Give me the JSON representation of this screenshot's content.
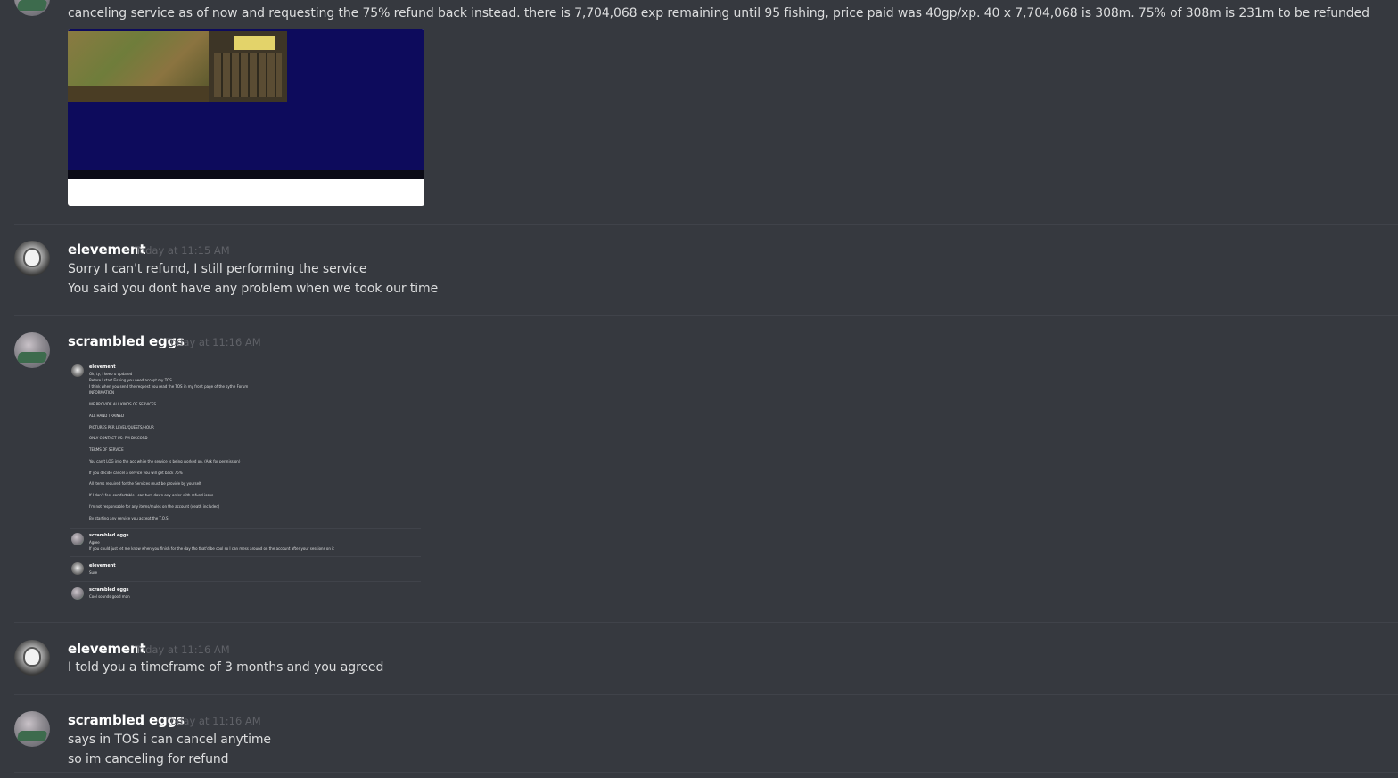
{
  "messages": [
    {
      "author": "scrambled eggs",
      "lines": [
        "canceling service as of now and requesting the 75% refund back instead. there is 7,704,068 exp remaining until 95 fishing, price paid was 40gp/xp. 40 x 7,704,068 is 308m. 75% of 308m is 231m to be  refunded"
      ]
    },
    {
      "author": "elevement",
      "timestamp": "Today at 11:15 AM",
      "lines": [
        "Sorry I can't refund, I still performing the service",
        "You said you dont have any problem when we took our time"
      ]
    },
    {
      "author": "scrambled eggs",
      "timestamp": "Today at 11:16 AM",
      "embed": {
        "messages": [
          {
            "author": "elevement",
            "lines": [
              "Ok, ty, I keep u updated",
              "Before I start Fishing you need accept my TOS",
              "I think when you send the request you read the TOS in my front page of the sythe Forum",
              "INFORMATION",
              "WE PROVIDE ALL KINDS OF SERVICES",
              "ALL HAND TRAINED",
              "PICTURES PER LEVEL/QUESTS/HOUR",
              "ONLY CONTACT US: PM DISCORD",
              "TERMS OF SERVICE",
              "You can't LOG into the acc while the service is being worked on. (Ask for permission)",
              "If you decide cancel a service you will get back 75%",
              "All items required for the Services must be provide by yourself",
              "If I don't feel comfortable I can turn down any order with refund issue",
              "I'm not responsable for any items/mules on the account (death included)",
              "By starting any service you accept the T.O.S."
            ]
          },
          {
            "author": "scrambled eggs",
            "lines": [
              "Agree",
              "If you could just let me know when you finish for the day tho that'd be cool so I can mess around on the account after your sessions on it"
            ]
          },
          {
            "author": "elevement",
            "lines": [
              "Sure"
            ]
          },
          {
            "author": "scrambled eggs",
            "lines": [
              "Cool sounds good man"
            ]
          }
        ]
      }
    },
    {
      "author": "elevement",
      "timestamp": "Today at 11:16 AM",
      "lines": [
        "I told you a timeframe of 3 months and you agreed"
      ]
    },
    {
      "author": "scrambled eggs",
      "timestamp": "Today at 11:16 AM",
      "lines": [
        "says in TOS i can cancel anytime",
        "so im canceling for refund"
      ]
    }
  ]
}
